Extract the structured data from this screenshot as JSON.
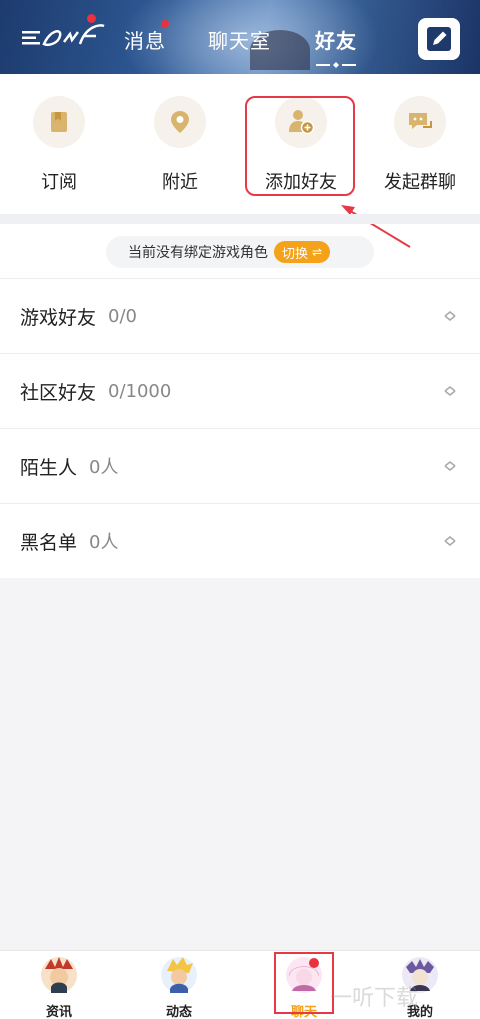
{
  "header": {
    "tabs": [
      {
        "label": "消息",
        "has_badge": true
      },
      {
        "label": "聊天室",
        "has_badge": false
      },
      {
        "label": "好友",
        "active": true
      }
    ],
    "logo_icon": "dnf-logo-icon",
    "edit_icon": "edit-icon",
    "badge_color": "#e8323c"
  },
  "quick_actions": [
    {
      "label": "订阅",
      "icon": "bookmark-icon"
    },
    {
      "label": "附近",
      "icon": "location-pin-icon"
    },
    {
      "label": "添加好友",
      "icon": "add-friend-icon"
    },
    {
      "label": "发起群聊",
      "icon": "group-chat-icon"
    }
  ],
  "notice": {
    "text": "当前没有绑定游戏角色",
    "switch_label": "切换",
    "switch_icon": "⇌",
    "accent": "#f5a21b"
  },
  "friend_groups": [
    {
      "name": "游戏好友",
      "count": "0/0"
    },
    {
      "name": "社区好友",
      "count": "0/1000"
    },
    {
      "name": "陌生人",
      "count": "0人"
    },
    {
      "name": "黑名单",
      "count": "0人"
    }
  ],
  "bottom_nav": [
    {
      "label": "资讯",
      "icon": "news-avatar-icon"
    },
    {
      "label": "动态",
      "icon": "feed-avatar-icon"
    },
    {
      "label": "聊天",
      "icon": "chat-avatar-icon",
      "active": true
    },
    {
      "label": "我的",
      "icon": "profile-avatar-icon"
    }
  ],
  "watermark": "一听下载"
}
